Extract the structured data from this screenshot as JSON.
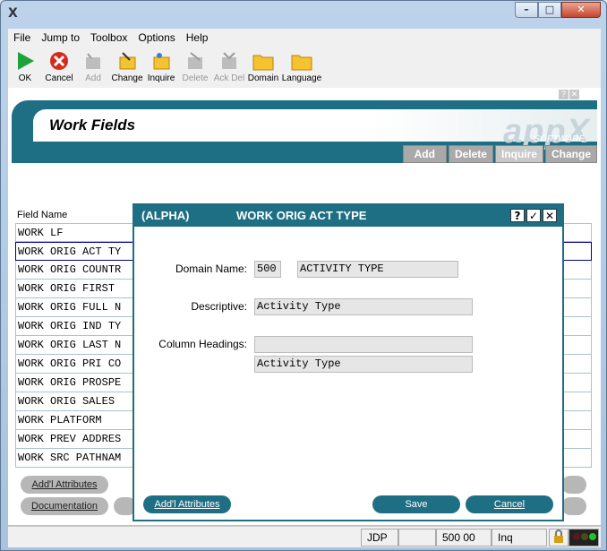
{
  "window": {
    "minimize": "–",
    "maximize": "□",
    "close": "✕",
    "app_icon": "X"
  },
  "menu": [
    "File",
    "Jump to",
    "Toolbox",
    "Options",
    "Help"
  ],
  "toolbar": [
    {
      "label": "OK",
      "icon": "ok-icon",
      "enabled": true
    },
    {
      "label": "Cancel",
      "icon": "cancel-icon",
      "enabled": true
    },
    {
      "label": "Add",
      "icon": "add-icon",
      "enabled": false
    },
    {
      "label": "Change",
      "icon": "change-icon",
      "enabled": true
    },
    {
      "label": "Inquire",
      "icon": "inquire-icon",
      "enabled": true
    },
    {
      "label": "Delete",
      "icon": "delete-icon",
      "enabled": false
    },
    {
      "label": "Ack Del",
      "icon": "ack-del-icon",
      "enabled": false
    },
    {
      "label": "Domain",
      "icon": "domain-icon",
      "enabled": true
    },
    {
      "label": "Language",
      "icon": "language-icon",
      "enabled": true
    }
  ],
  "header": {
    "title": "Work Fields",
    "logo": "appX",
    "logo_sub": "SOFTWARE",
    "help_icon": "?",
    "close_icon": "✕",
    "buttons": [
      "Add",
      "Delete",
      "Inquire",
      "Change"
    ]
  },
  "list": {
    "column_header": "Field Name",
    "rows": [
      "WORK LF",
      "WORK ORIG ACT TY",
      "WORK ORIG COUNTR",
      "WORK ORIG FIRST",
      "WORK ORIG FULL N",
      "WORK ORIG IND TY",
      "WORK ORIG LAST N",
      "WORK ORIG PRI CO",
      "WORK ORIG PROSPE",
      "WORK ORIG SALES",
      "WORK PLATFORM",
      "WORK PREV ADDRES",
      "WORK SRC PATHNAM"
    ],
    "selected_index": 1
  },
  "bottom_buttons": [
    "Add'l Attributes",
    "Documentation"
  ],
  "status": {
    "user": "JDP",
    "number": "500 00",
    "mode": "Inq"
  },
  "dialog": {
    "type_label": "(ALPHA)",
    "title": "WORK ORIG ACT TYPE",
    "help": "?",
    "ok": "✓",
    "close": "✕",
    "domain_label": "Domain Name:",
    "domain_app": "500",
    "domain_value": "ACTIVITY TYPE",
    "descriptive_label": "Descriptive:",
    "descriptive_value": "Activity Type",
    "col_heading_label": "Column Headings:",
    "col_heading_1": "",
    "col_heading_2": "Activity Type",
    "addl_button": "Add'l Attributes",
    "save_button": "Save",
    "cancel_button": "Cancel"
  }
}
